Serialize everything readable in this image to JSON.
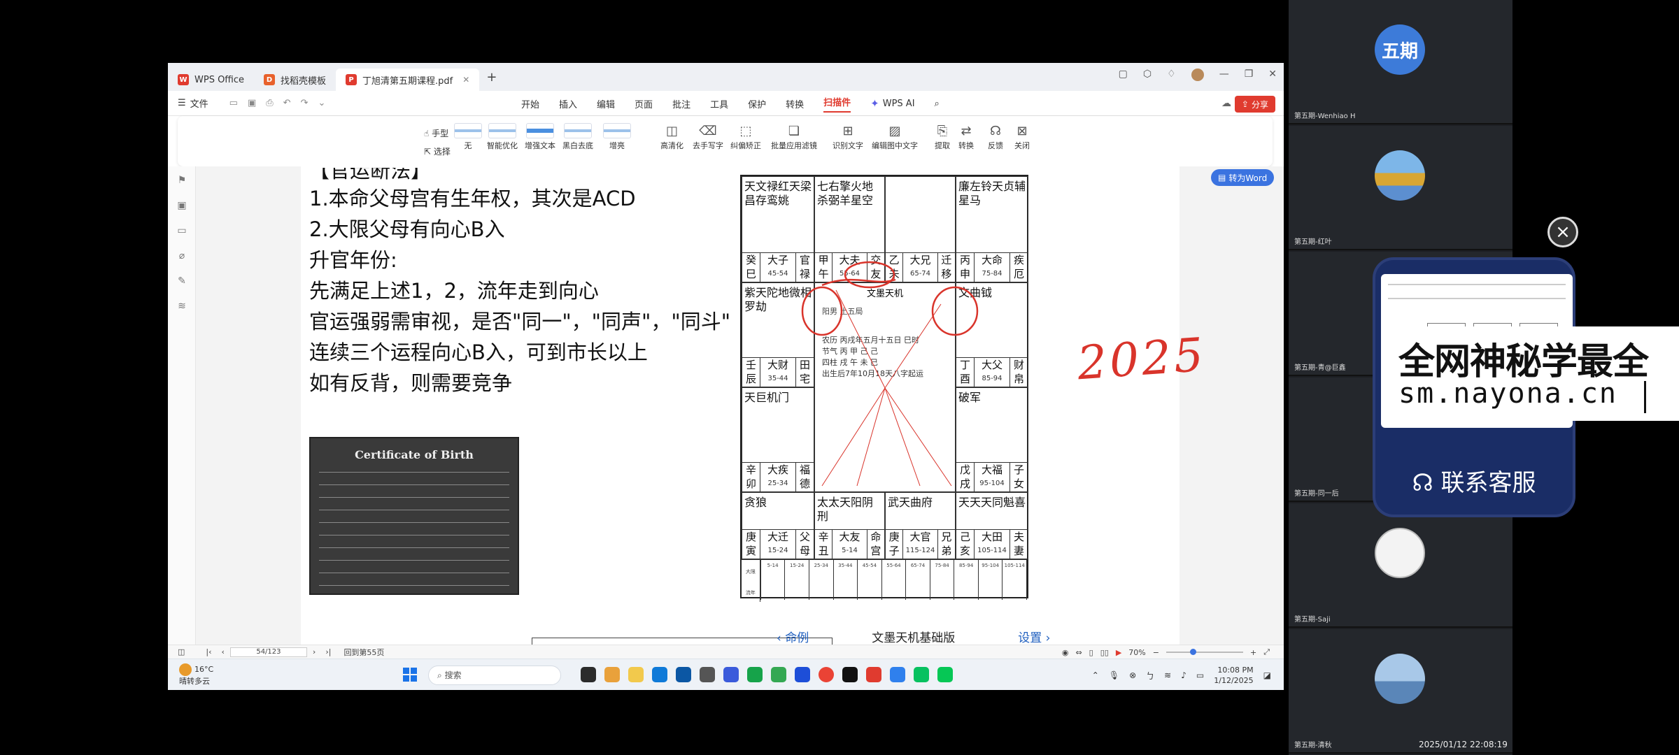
{
  "tabs": [
    {
      "label": "WPS Office",
      "logo": "W"
    },
    {
      "label": "找稻壳模板",
      "logo": "D"
    },
    {
      "label": "丁旭清第五期课程.pdf",
      "logo": "P"
    }
  ],
  "menubar": {
    "file": "文件",
    "menus": [
      "开始",
      "插入",
      "编辑",
      "页面",
      "批注",
      "工具",
      "保护",
      "转换",
      "扫描件"
    ],
    "active_menu": "扫描件",
    "wps_ai": "WPS AI",
    "share": "分享"
  },
  "ribbon": {
    "hand": "手型",
    "select": "选择",
    "items": [
      "无",
      "智能优化",
      "增强文本",
      "黑白去底",
      "增亮",
      "高清化",
      "去手写字",
      "纠偏矫正",
      "批量应用滤镜",
      "识别文字",
      "编辑图中文字",
      "提取",
      "转换",
      "反馈",
      "关闭"
    ]
  },
  "to_word": "转为Word",
  "notes": {
    "heading_cut": "【官运断法】",
    "lines": [
      "1.本命父母宫有生年权，其次是ACD",
      "2.大限父母有向心B入",
      "升官年份:",
      "先满足上述1，2，流年走到向心",
      "官运强弱需审视，是否\"同一\"，\"同声\"，\"同斗\"",
      "连续三个运程向心B入，可到市长以上",
      "如有反背，则需要竞争"
    ]
  },
  "certificate": {
    "title": "Certificate of Birth"
  },
  "chart": {
    "cells": [
      {
        "stars": "天文禄红天梁昌存鸾姚",
        "gz": [
          "癸巳",
          "大子",
          "45-54",
          "官禄"
        ]
      },
      {
        "stars": "七右擎火地杀弼羊星空",
        "gz": [
          "甲午",
          "大夫",
          "55-64",
          "交友"
        ]
      },
      {
        "stars": "",
        "gz": [
          "乙未",
          "大兄",
          "65-74",
          "迁移"
        ]
      },
      {
        "stars": "廉左铃天贞辅星马",
        "gz": [
          "丙申",
          "大命",
          "75-84",
          "疾厄"
        ]
      },
      {
        "stars": "紫天陀地微相罗劫",
        "gz": [
          "壬辰",
          "大财",
          "35-44",
          "田宅"
        ]
      },
      {
        "stars": "文曲钺",
        "gz": [
          "丁酉",
          "大父",
          "85-94",
          "财帛"
        ]
      },
      {
        "stars": "天巨机门",
        "gz": [
          "辛卯",
          "大疾",
          "25-34",
          "福德"
        ]
      },
      {
        "stars": "破军",
        "gz": [
          "戊戌",
          "大福",
          "95-104",
          "子女"
        ]
      },
      {
        "stars": "贪狼",
        "gz": [
          "庚寅",
          "大迁",
          "15-24",
          "父母"
        ]
      },
      {
        "stars": "太太天阳阴刑",
        "gz": [
          "辛丑",
          "大友",
          "5-14",
          "命宫"
        ]
      },
      {
        "stars": "武天曲府",
        "gz": [
          "庚子",
          "大官",
          "115-124",
          "兄弟"
        ]
      },
      {
        "stars": "天天天同魁喜",
        "gz": [
          "己亥",
          "大田",
          "105-114",
          "夫妻"
        ]
      }
    ],
    "center_title": "文墨天机",
    "center_info": "阳男  土五局",
    "center_lines": [
      "农历 丙戌年五月十五日 巳时",
      "节气 丙  甲  己  己",
      "四柱 戌  午  未  巳",
      "出生后7年10月18天八字起运"
    ],
    "bottom_headers": [
      "大限",
      "流年"
    ],
    "handwriting": "2025"
  },
  "preview_bar": {
    "back": "命例",
    "title": "文墨天机基础版",
    "settings": "设置"
  },
  "statusbar": {
    "page": "54/123",
    "goto": "回到第55页",
    "zoom": "70%"
  },
  "taskbar": {
    "temp": "16°C",
    "weather": "晴转多云",
    "search": "搜索",
    "time": "10:08 PM",
    "date": "1/12/2025"
  },
  "participants": [
    {
      "name": "第五期-Wenhiao H",
      "avatar_text": "五期"
    },
    {
      "name": "第五期-红叶",
      "avatar_text": ""
    },
    {
      "name": "第五期-青@巨鑫",
      "avatar_text": ""
    },
    {
      "name": "第五期-同一后",
      "avatar_text": ""
    },
    {
      "name": "第五期-Saji",
      "avatar_text": ""
    },
    {
      "name": "第五期-清秋",
      "avatar_text": ""
    }
  ],
  "ad": {
    "line1": "全网神秘学最全",
    "line2": "sm.nayona.cn",
    "service": "联系客服"
  },
  "timestamp": "2025/01/12 22:08:19",
  "colors": {
    "accent": "#e03b2f",
    "blue": "#3b73e0",
    "ink": "#d9342b"
  }
}
